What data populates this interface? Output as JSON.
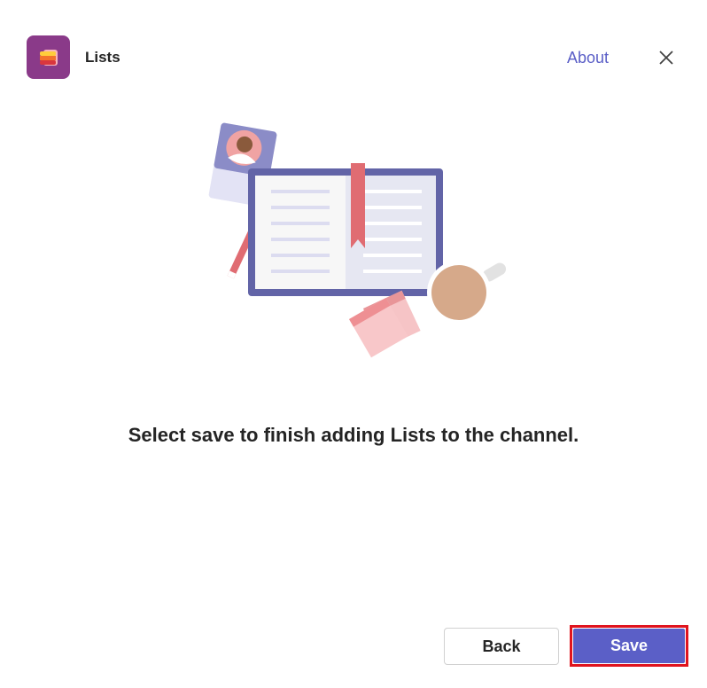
{
  "header": {
    "app_name": "Lists",
    "app_icon": "lists-app-icon",
    "about_label": "About",
    "close_icon": "close-icon"
  },
  "main": {
    "illustration": "notebook-illustration",
    "message": "Select save to finish adding Lists to the channel."
  },
  "footer": {
    "back_label": "Back",
    "save_label": "Save"
  },
  "colors": {
    "accent": "#5b5fc7",
    "app_icon_bg": "#8a3a89",
    "highlight_border": "#e0141e"
  }
}
